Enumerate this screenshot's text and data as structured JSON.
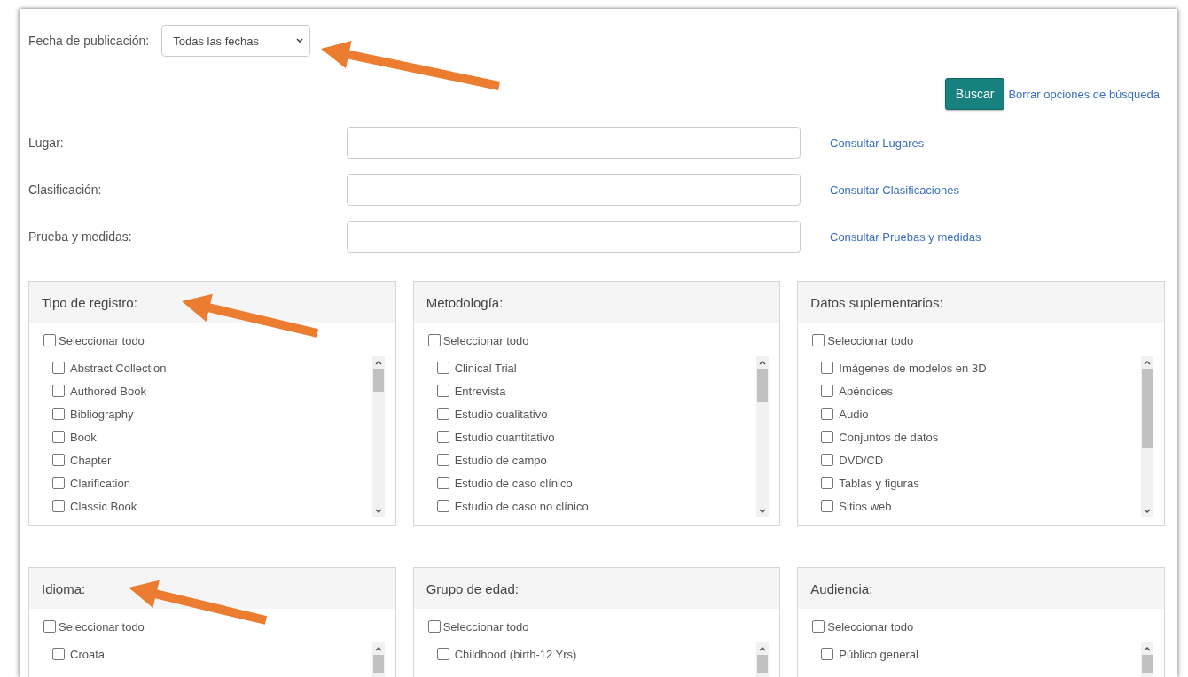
{
  "date_filter": {
    "label": "Fecha de publicación:",
    "value": "Todas las fechas"
  },
  "actions": {
    "search_button": "Buscar",
    "clear_link": "Borrar opciones de búsqueda"
  },
  "fields": [
    {
      "label": "Lugar:",
      "link": "Consultar Lugares"
    },
    {
      "label": "Clasificación:",
      "link": "Consultar Clasificaciones"
    },
    {
      "label": "Prueba y medidas:",
      "link": "Consultar Pruebas y medidas"
    }
  ],
  "panels": [
    {
      "title": "Tipo de registro:",
      "select_all": {
        "label": "Seleccionar todo",
        "checked": false
      },
      "items": [
        {
          "label": "Abstract Collection",
          "checked": false
        },
        {
          "label": "Authored Book",
          "checked": false
        },
        {
          "label": "Bibliography",
          "checked": false
        },
        {
          "label": "Book",
          "checked": false
        },
        {
          "label": "Chapter",
          "checked": false
        },
        {
          "label": "Clarification",
          "checked": false
        },
        {
          "label": "Classic Book",
          "checked": false
        }
      ]
    },
    {
      "title": "Metodología:",
      "select_all": {
        "label": "Seleccionar todo",
        "checked": false
      },
      "items": [
        {
          "label": "Clinical Trial",
          "checked": false
        },
        {
          "label": "Entrevista",
          "checked": false
        },
        {
          "label": "Estudio cualitativo",
          "checked": false
        },
        {
          "label": "Estudio cuantitativo",
          "checked": false
        },
        {
          "label": "Estudio de campo",
          "checked": false
        },
        {
          "label": "Estudio de caso clínico",
          "checked": false
        },
        {
          "label": "Estudio de caso no clínico",
          "checked": false
        }
      ]
    },
    {
      "title": "Datos suplementarios:",
      "select_all": {
        "label": "Seleccionar todo",
        "checked": false
      },
      "items": [
        {
          "label": "Imágenes de modelos en 3D",
          "checked": false
        },
        {
          "label": "Apéndices",
          "checked": false
        },
        {
          "label": "Audio",
          "checked": false
        },
        {
          "label": "Conjuntos de datos",
          "checked": false
        },
        {
          "label": "DVD/CD",
          "checked": false
        },
        {
          "label": "Tablas y figuras",
          "checked": false
        },
        {
          "label": "Sitios web",
          "checked": false
        }
      ]
    },
    {
      "title": "Idioma:",
      "select_all": {
        "label": "Seleccionar todo",
        "checked": false
      },
      "items": [
        {
          "label": "Croata",
          "checked": false
        }
      ]
    },
    {
      "title": "Grupo de edad:",
      "select_all": {
        "label": "Seleccionar todo",
        "checked": false
      },
      "items": [
        {
          "label": "Childhood (birth-12 Yrs)",
          "checked": false
        }
      ]
    },
    {
      "title": "Audiencia:",
      "select_all": {
        "label": "Seleccionar todo",
        "checked": false
      },
      "items": [
        {
          "label": "Público general",
          "checked": false
        }
      ]
    }
  ]
}
